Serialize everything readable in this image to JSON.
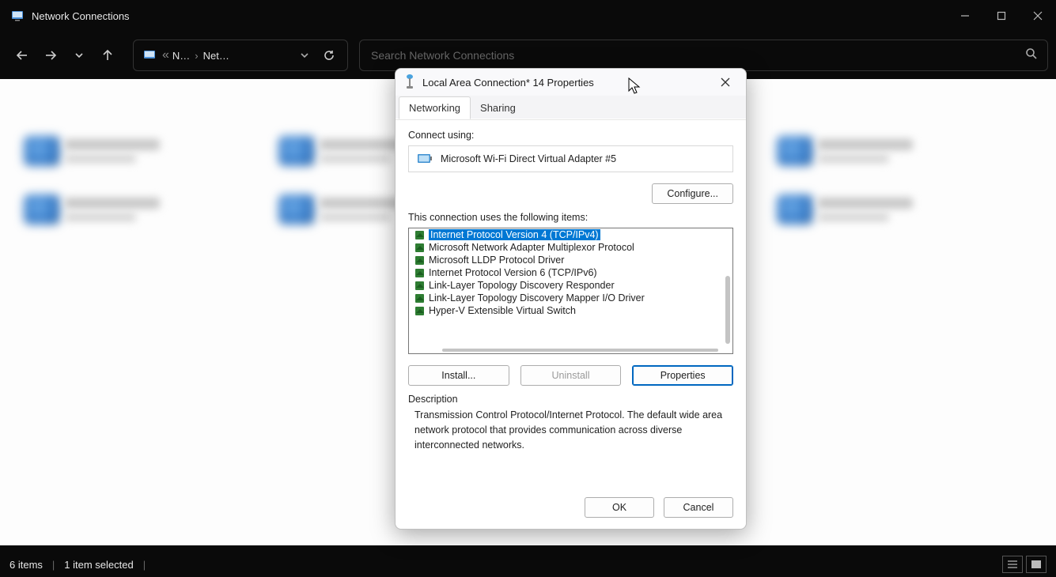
{
  "window": {
    "title": "Network Connections"
  },
  "breadcrumb": {
    "level1": "N…",
    "level2": "Net…"
  },
  "search": {
    "placeholder": "Search Network Connections"
  },
  "statusbar": {
    "items_count": "6 items",
    "selected": "1 item selected"
  },
  "dialog": {
    "title": "Local Area Connection* 14 Properties",
    "tabs": {
      "networking": "Networking",
      "sharing": "Sharing"
    },
    "connect_using_label": "Connect using:",
    "adapter_name": "Microsoft Wi-Fi Direct Virtual Adapter #5",
    "configure_label": "Configure...",
    "uses_items_label": "This connection uses the following items:",
    "items": [
      "Internet Protocol Version 4 (TCP/IPv4)",
      "Microsoft Network Adapter Multiplexor Protocol",
      "Microsoft LLDP Protocol Driver",
      "Internet Protocol Version 6 (TCP/IPv6)",
      "Link-Layer Topology Discovery Responder",
      "Link-Layer Topology Discovery Mapper I/O Driver",
      "Hyper-V Extensible Virtual Switch"
    ],
    "install_label": "Install...",
    "uninstall_label": "Uninstall",
    "properties_label": "Properties",
    "description_label": "Description",
    "description_text": "Transmission Control Protocol/Internet Protocol. The default wide area network protocol that provides communication across diverse interconnected networks.",
    "ok_label": "OK",
    "cancel_label": "Cancel"
  }
}
